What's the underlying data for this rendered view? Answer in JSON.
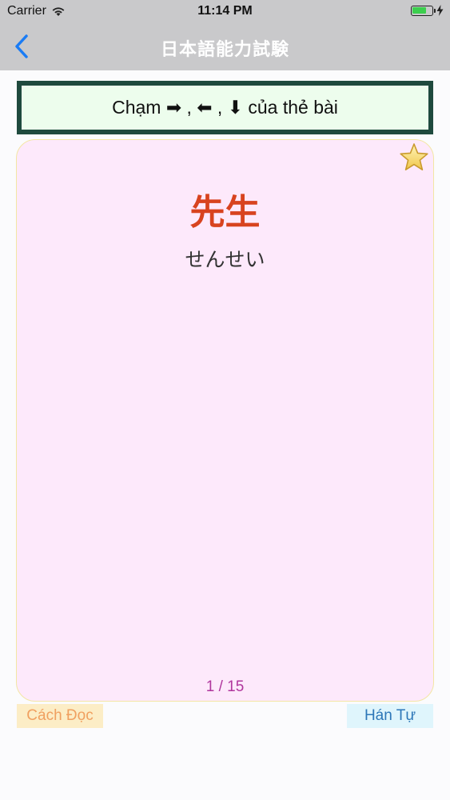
{
  "status": {
    "carrier": "Carrier",
    "time": "11:14 PM",
    "battery_level": 0.75
  },
  "nav": {
    "title": "日本語能力試験"
  },
  "hint": {
    "text": "Chạm ➡ , ⬅ , ⬇ của thẻ bài"
  },
  "card": {
    "kanji": "先生",
    "reading": "せんせい",
    "counter": "1 / 15"
  },
  "buttons": {
    "reading_label": "Cách Đọc",
    "kanji_label": "Hán Tự"
  },
  "colors": {
    "accent_back": "#1a7cf5",
    "kanji": "#d8431f",
    "counter": "#b0369d",
    "card_bg": "#fde9fb",
    "hint_border": "#1f4a3e"
  }
}
